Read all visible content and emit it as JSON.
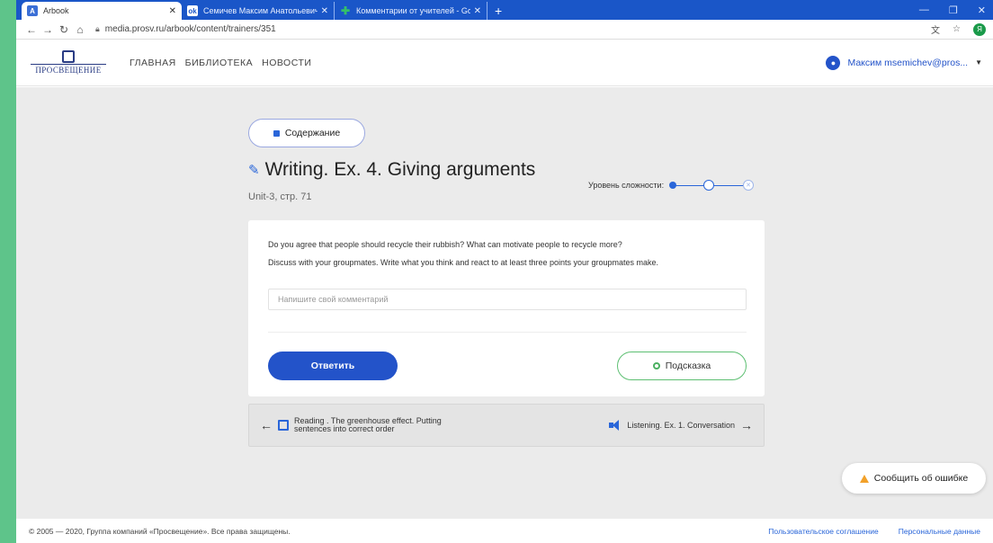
{
  "browser": {
    "tabs": [
      {
        "favicon": "arbook-icon",
        "title": "Arbook",
        "active": true
      },
      {
        "favicon": "ok-icon",
        "title": "Семичев Максим Анатольевич",
        "active": false
      },
      {
        "favicon": "plus-icon",
        "title": "Комментарии от учителей - Go",
        "active": false
      }
    ],
    "url": "media.prosv.ru/arbook/content/trainers/351",
    "profile_initial": "Я"
  },
  "header": {
    "logo_text": "ПРОСВЕЩЕНИЕ",
    "nav": [
      "ГЛАВНАЯ",
      "БИБЛИОТЕКА",
      "НОВОСТИ"
    ],
    "user_label": "Максим msemichev@pros..."
  },
  "exercise": {
    "contents_label": "Содержание",
    "title": "Writing. Ex. 4. Giving arguments",
    "subtitle": "Unit-3, стр. 71",
    "level_label": "Уровень сложности:",
    "level_value": 2,
    "level_max": 3,
    "prompt_line1": "Do you agree that people should recycle their rubbish? What can motivate people to recycle more?",
    "prompt_line2": "Discuss with your groupmates. Write what you think and react to at least three points your groupmates make.",
    "comment_placeholder": "Напишите свой комментарий",
    "answer_label": "Ответить",
    "hint_label": "Подсказка"
  },
  "navigation": {
    "prev_line1": "Reading . The greenhouse effect. Putting",
    "prev_line2": "sentences into correct order",
    "next_label": "Listening. Ex. 1. Conversation"
  },
  "report_label": "Сообщить об ошибке",
  "footer": {
    "copyright": "© 2005 — 2020, Группа компаний «Просвещение». Все права защищены.",
    "links": [
      "Пользовательское соглашение",
      "Персональные данные"
    ]
  },
  "colors": {
    "accent": "#2353c9",
    "hint_border": "#5dbf72",
    "warning": "#f2a12a",
    "page_bg": "#ebebeb"
  }
}
